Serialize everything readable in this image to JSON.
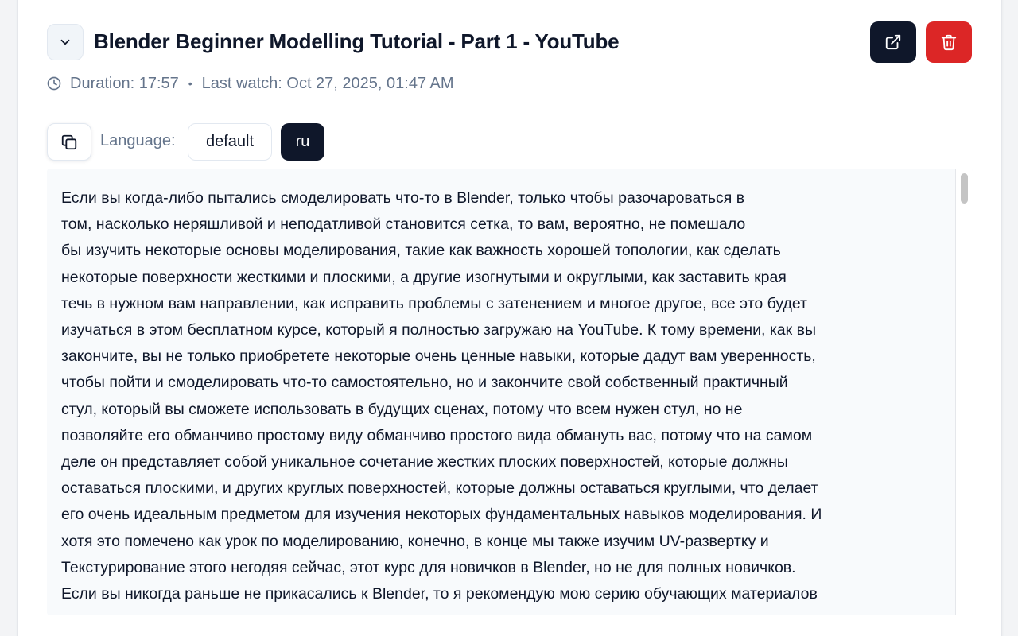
{
  "video": {
    "title": "Blender Beginner Modelling Tutorial - Part 1 - YouTube",
    "duration_text": "Duration: 17:57",
    "separator": "•",
    "last_watch_text": "Last watch: Oct 27, 2025, 01:47 AM"
  },
  "language": {
    "label": "Language:",
    "options": [
      "default",
      "ru"
    ],
    "selected": "ru"
  },
  "transcript": {
    "text": " Если вы когда-либо пытались смоделировать что-то в Blender, только чтобы разочароваться в\nтом, насколько неряшливой и неподатливой становится сетка, то вам, вероятно, не помешало\nбы изучить некоторые основы моделирования, такие как важность хорошей топологии, как сделать\nнекоторые поверхности жесткими и плоскими, а другие изогнутыми и округлыми, как заставить края\nтечь в нужном вам направлении, как исправить проблемы с затенением и многое другое, все это будет\nизучаться в этом бесплатном курсе, который я полностью загружаю на YouTube. К тому времени, как вы\nзакончите, вы не только приобретете некоторые очень ценные навыки, которые дадут вам уверенность,\nчтобы пойти и смоделировать что-то самостоятельно, но и закончите свой собственный практичный\nстул, который вы сможете использовать в будущих сценах, потому что всем нужен стул, но не\nпозволяйте его обманчиво простому виду обманчиво простого вида обмануть вас, потому что на самом\nделе он представляет собой уникальное сочетание жестких плоских поверхностей, которые должны\nоставаться плоскими, и других круглых поверхностей, которые должны оставаться круглыми, что делает\nего очень идеальным предметом для изучения некоторых фундаментальных навыков моделирования. И\nхотя это помечено как урок по моделированию, конечно, в конце мы также изучим UV-развертку и\nТекстурирование этого негодяя сейчас, этот курс для новичков в Blender, но не для полных новичков.\nЕсли вы никогда раньше не прикасались к Blender, то я рекомендую мою серию обучающих материалов"
  },
  "icons": {
    "collapse": "chevron-down-icon",
    "open": "external-link-icon",
    "delete": "trash-icon",
    "duration": "clock-icon",
    "copy": "copy-icon"
  },
  "colors": {
    "primary_dark": "#0f172a",
    "danger": "#dc2626",
    "muted_text": "#64748b",
    "transcript_bg": "#f8fafc"
  }
}
